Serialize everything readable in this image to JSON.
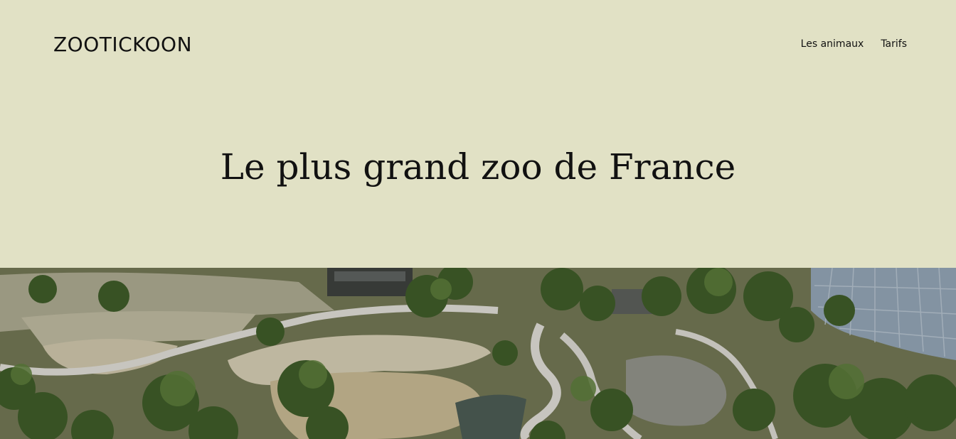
{
  "header": {
    "logo": "ZOOTICKOON",
    "nav": [
      {
        "label": "Les animaux"
      },
      {
        "label": "Tarifs"
      }
    ]
  },
  "hero": {
    "title": "Le plus grand zoo de France"
  },
  "photo": {
    "subject": "aerial view of zoo park",
    "colors": {
      "background": "#e1e1c5",
      "path": "#c9c6bd",
      "sand": "#bfb295",
      "trees": "#3e5a2a",
      "greenhouse": "#8fa0b0"
    }
  }
}
